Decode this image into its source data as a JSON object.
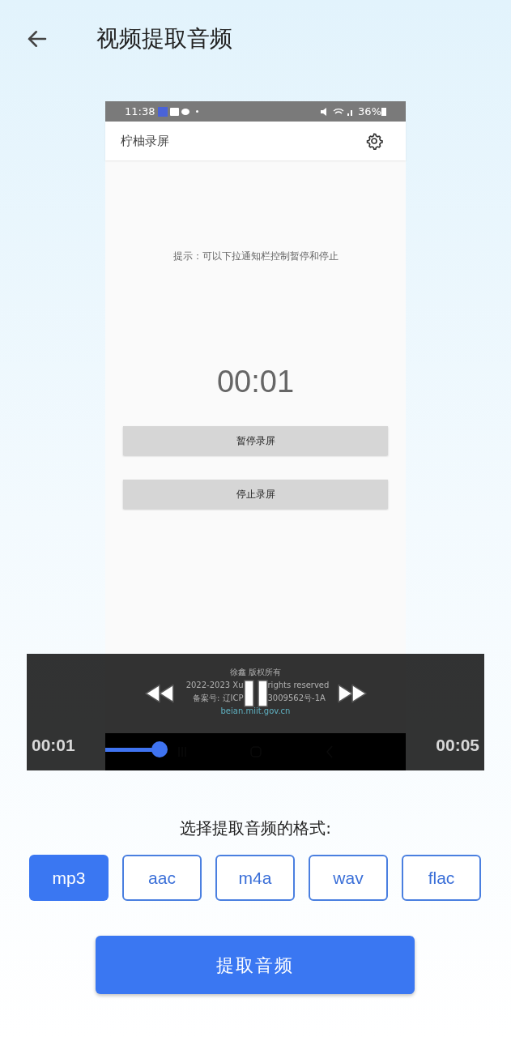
{
  "header": {
    "title": "视频提取音频"
  },
  "video": {
    "status_bar": {
      "time": "11:38",
      "battery": "36%"
    },
    "app_bar": {
      "title": "柠柚录屏"
    },
    "hint": "提示：可以下拉通知栏控制暂停和停止",
    "timer": "00:01",
    "buttons": [
      "暂停录屏",
      "停止录屏"
    ],
    "footer": [
      [
        "徐鑫 版权所有"
      ],
      [
        "2022-2023 Xu",
        "rights reserved"
      ],
      [
        "备案号: 辽ICP",
        "3009562号-1A"
      ],
      [
        "beian.miit.gov.cn"
      ]
    ],
    "player": {
      "elapsed": "00:01",
      "duration": "00:05",
      "level": 0.18,
      "playing": true
    }
  },
  "format_label": "选择提取音频的格式:",
  "formats": [
    {
      "label": "mp3",
      "selected": true
    },
    {
      "label": "aac",
      "selected": false
    },
    {
      "label": "m4a",
      "selected": false
    },
    {
      "label": "wav",
      "selected": false
    },
    {
      "label": "flac",
      "selected": false
    }
  ],
  "extract_button": "提取音频"
}
